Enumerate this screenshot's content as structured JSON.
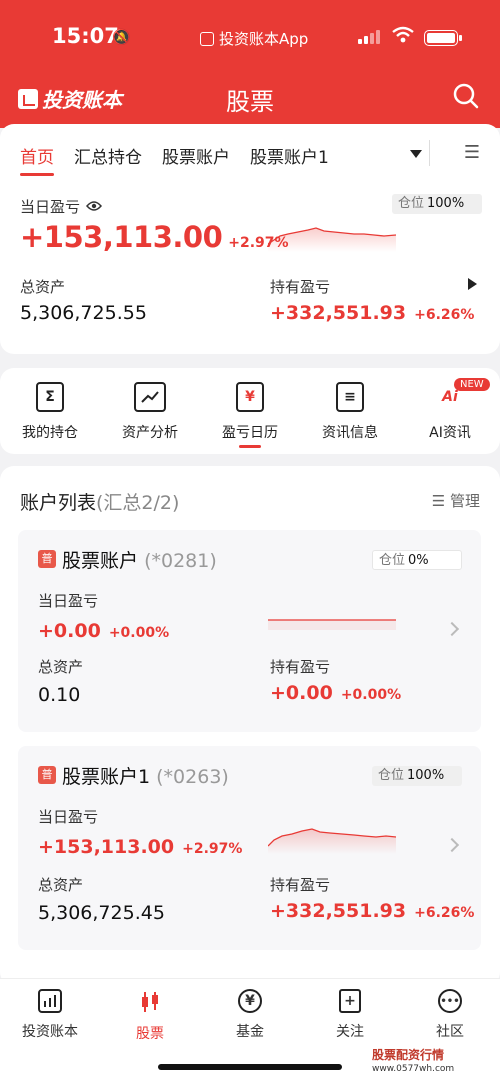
{
  "status": {
    "time": "15:07",
    "app_name": "投资账本App"
  },
  "header": {
    "logo": "投资账本",
    "title": "股票"
  },
  "tabs": [
    {
      "label": "首页"
    },
    {
      "label": "汇总持仓"
    },
    {
      "label": "股票账户"
    },
    {
      "label": "股票账户1"
    }
  ],
  "summary": {
    "today_label": "当日盈亏",
    "today_value": "+153,113.00",
    "today_pct": "+2.97%",
    "position_label": "仓位",
    "position_value": "100%",
    "total_assets_label": "总资产",
    "total_assets_value": "5,306,725.55",
    "holding_label": "持有盈亏",
    "holding_value": "+332,551.93",
    "holding_pct": "+6.26%"
  },
  "shortcuts": [
    {
      "label": "我的持仓",
      "icon": "sigma-icon"
    },
    {
      "label": "资产分析",
      "icon": "chart-icon"
    },
    {
      "label": "盈亏日历",
      "icon": "calendar-yen-icon"
    },
    {
      "label": "资讯信息",
      "icon": "document-icon"
    },
    {
      "label": "AI资讯",
      "icon": "ai-head-icon",
      "badge": "NEW"
    }
  ],
  "accounts_section": {
    "title": "账户列表",
    "subtitle": "(汇总2/2)",
    "manage": "管理"
  },
  "accounts": [
    {
      "badge": "普",
      "name": "股票账户",
      "code": "(*0281)",
      "position_label": "仓位",
      "position_value": "0%",
      "today_label": "当日盈亏",
      "today_value": "+0.00",
      "today_pct": "+0.00%",
      "assets_label": "总资产",
      "assets_value": "0.10",
      "holding_label": "持有盈亏",
      "holding_value": "+0.00",
      "holding_pct": "+0.00%"
    },
    {
      "badge": "普",
      "name": "股票账户1",
      "code": "(*0263)",
      "position_label": "仓位",
      "position_value": "100%",
      "today_label": "当日盈亏",
      "today_value": "+153,113.00",
      "today_pct": "+2.97%",
      "assets_label": "总资产",
      "assets_value": "5,306,725.45",
      "holding_label": "持有盈亏",
      "holding_value": "+332,551.93",
      "holding_pct": "+6.26%"
    }
  ],
  "bottom_nav": [
    {
      "label": "投资账本",
      "icon": "bar-chart-icon"
    },
    {
      "label": "股票",
      "icon": "candlestick-icon"
    },
    {
      "label": "基金",
      "icon": "yen-circle-icon"
    },
    {
      "label": "关注",
      "icon": "bookmark-plus-icon"
    },
    {
      "label": "社区",
      "icon": "chat-bubble-icon"
    }
  ],
  "watermark": {
    "title": "股票配资行情",
    "url": "www.0577wh.com"
  },
  "colors": {
    "accent": "#e83a35",
    "background": "#f2f2f4"
  }
}
